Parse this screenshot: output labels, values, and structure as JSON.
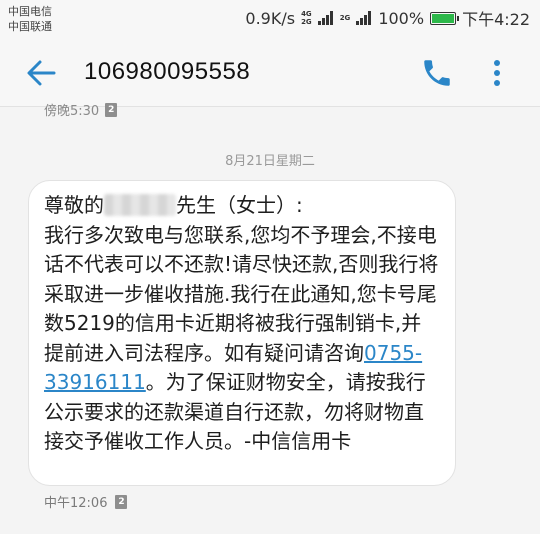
{
  "status_bar": {
    "carrier_1": "中国电信",
    "carrier_2": "中国联通",
    "net_speed": "0.9K/s",
    "net_type_1": "4G",
    "net_type_1b": "2G",
    "net_type_2": "2G",
    "battery": "100%",
    "time": "下午4:22"
  },
  "header": {
    "contact": "106980095558",
    "icons": [
      "back-arrow-icon",
      "phone-icon",
      "more-vert-icon"
    ]
  },
  "previous_message": {
    "time": "傍晚5:30",
    "sim": "2"
  },
  "date_separator": "8月21日星期二",
  "message": {
    "greeting_start": "尊敬的",
    "greeting_end": "先生（女士）:",
    "body_before_phone": "我行多次致电与您联系,您均不予理会,不接电话不代表可以不还款!请尽快还款,否则我行将采取进一步催收措施.我行在此通知,您卡号尾数5219的信用卡近期将被我行强制销卡,并提前进入司法程序。如有疑问请咨询",
    "phone": "0755-33916111",
    "body_after_phone": "。为了保证财物安全，请按我行公示要求的还款渠道自行还款，勿将财物直接交予催收工作人员。-中信信用卡",
    "time": "中午12:06",
    "sim": "2"
  },
  "colors": {
    "accent": "#2b86c8",
    "battery": "#2db84a"
  }
}
